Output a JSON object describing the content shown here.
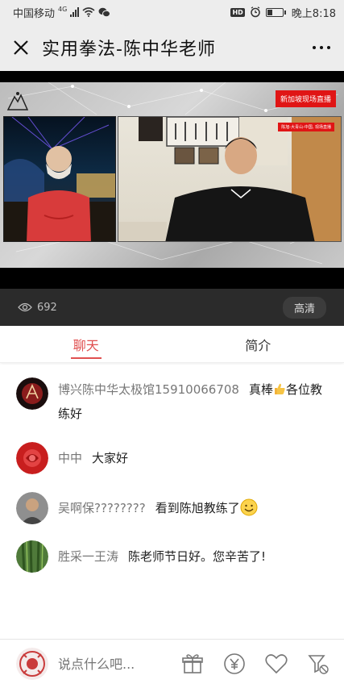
{
  "status_bar": {
    "carrier": "中国移动",
    "network": "4G",
    "time": "晚上8:18",
    "hd_label": "HD",
    "icons": [
      "signal-icon",
      "wifi-icon",
      "wechat-icon",
      "alarm-icon",
      "battery-icon"
    ]
  },
  "title_bar": {
    "title": "实用拳法-陈中华老师",
    "close_icon": "close-icon",
    "more_icon": "more-icon"
  },
  "video": {
    "badge": "新加坡现场直播",
    "badge_small": "陈旭-大青山-中国, 现场直播",
    "views": "692",
    "quality": "高清"
  },
  "tabs": [
    {
      "label": "聊天",
      "active": true
    },
    {
      "label": "简介",
      "active": false
    }
  ],
  "messages": [
    {
      "name": "博兴陈中华太极馆15910066708",
      "text_before": "真棒",
      "text_after": "各位教练好",
      "emoji": "thumbs-up"
    },
    {
      "name": "中中",
      "text": "大家好"
    },
    {
      "name": "吴啊保????????",
      "text": "看到陈旭教练了",
      "emoji": "smile"
    },
    {
      "name": "胜采一王涛",
      "text": "陈老师节日好。您辛苦了!"
    }
  ],
  "footer": {
    "placeholder": "说点什么吧...",
    "icons": [
      "gift-icon",
      "yen-icon",
      "heart-icon",
      "filter-icon"
    ]
  },
  "colors": {
    "accent": "#e05050",
    "video_badge": "#e01515",
    "bar_bg": "#ededed",
    "video_bar": "#2b2b2b"
  }
}
